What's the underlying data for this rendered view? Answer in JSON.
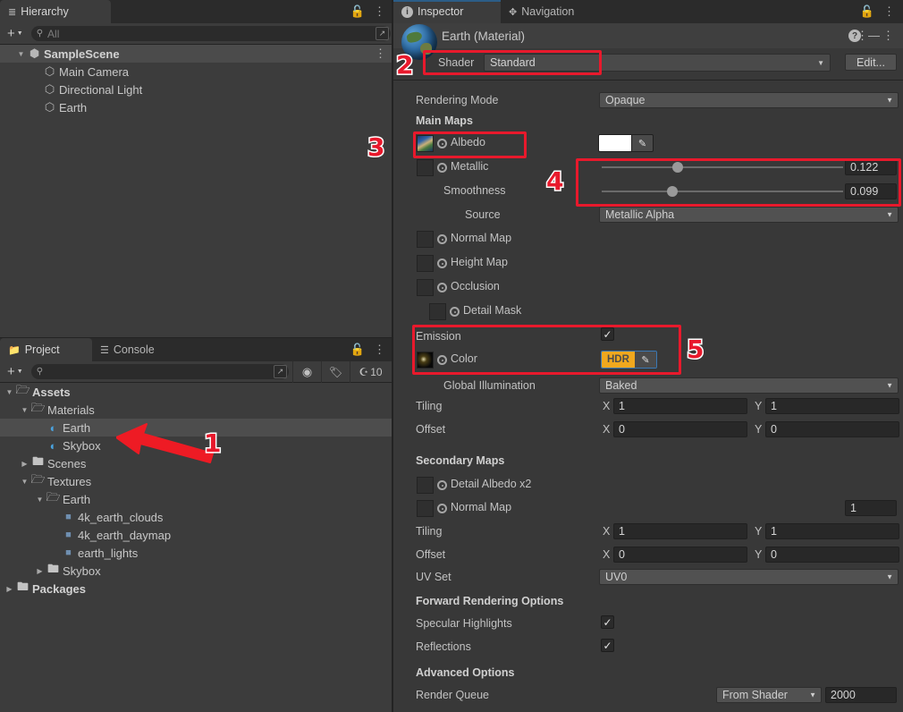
{
  "hierarchy": {
    "tab_label": "Hierarchy",
    "tab_icon": "hierarchy-icon",
    "lock_icon": "lock-icon",
    "menu_icon": "kebab-menu-icon",
    "add_label": "+",
    "search_placeholder": "All",
    "items": [
      {
        "label": "SampleScene",
        "icon": "scene-icon",
        "depth": 0,
        "expanded": true,
        "selected": false,
        "bold": true
      },
      {
        "label": "Main Camera",
        "icon": "gameobject-cube-icon",
        "depth": 1,
        "expanded": null,
        "selected": false,
        "bold": false
      },
      {
        "label": "Directional Light",
        "icon": "gameobject-cube-icon",
        "depth": 1,
        "expanded": null,
        "selected": false,
        "bold": false
      },
      {
        "label": "Earth",
        "icon": "gameobject-cube-icon",
        "depth": 1,
        "expanded": null,
        "selected": false,
        "bold": false
      }
    ]
  },
  "project": {
    "tab_label": "Project",
    "console_tab_label": "Console",
    "search_placeholder": "",
    "hidden_count": "10",
    "icons": [
      "folder-icon",
      "console-icon",
      "lock-icon",
      "kebab-menu-icon",
      "search-expand-icon",
      "shape-filter-icon",
      "tag-filter-icon",
      "hidden-eye-icon"
    ],
    "items": [
      {
        "label": "Assets",
        "icon": "folder-open-icon",
        "depth": 0,
        "expanded": true,
        "selected": false,
        "bold": true
      },
      {
        "label": "Materials",
        "icon": "folder-open-icon",
        "depth": 1,
        "expanded": true,
        "selected": false,
        "bold": false
      },
      {
        "label": "Earth",
        "icon": "material-ball-icon",
        "depth": 2,
        "expanded": null,
        "selected": true,
        "bold": false
      },
      {
        "label": "Skybox",
        "icon": "material-ball-icon",
        "depth": 2,
        "expanded": null,
        "selected": false,
        "bold": false
      },
      {
        "label": "Scenes",
        "icon": "folder-icon",
        "depth": 1,
        "expanded": false,
        "selected": false,
        "bold": false
      },
      {
        "label": "Textures",
        "icon": "folder-open-icon",
        "depth": 1,
        "expanded": true,
        "selected": false,
        "bold": false
      },
      {
        "label": "Earth",
        "icon": "folder-open-icon",
        "depth": 2,
        "expanded": true,
        "selected": false,
        "bold": false
      },
      {
        "label": "4k_earth_clouds",
        "icon": "texture-icon",
        "depth": 3,
        "expanded": null,
        "selected": false,
        "bold": false
      },
      {
        "label": "4k_earth_daymap",
        "icon": "texture-icon",
        "depth": 3,
        "expanded": null,
        "selected": false,
        "bold": false
      },
      {
        "label": "earth_lights",
        "icon": "texture-icon",
        "depth": 3,
        "expanded": null,
        "selected": false,
        "bold": false
      },
      {
        "label": "Skybox",
        "icon": "folder-icon",
        "depth": 2,
        "expanded": false,
        "selected": false,
        "bold": false
      },
      {
        "label": "Packages",
        "icon": "folder-icon",
        "depth": 0,
        "expanded": false,
        "selected": false,
        "bold": true
      }
    ]
  },
  "inspector": {
    "tab_label": "Inspector",
    "tab_icon": "info-icon",
    "navigation_tab_label": "Navigation",
    "navigation_tab_icon": "navigation-icon",
    "lock_icon": "lock-icon",
    "menu_icon": "kebab-menu-icon",
    "help_icon": "help-icon",
    "preset_icon": "preset-icon",
    "material_title": "Earth (Material)",
    "material_preview_icon": "earth-globe-icon",
    "shader_label": "Shader",
    "shader_value": "Standard",
    "edit_button": "Edit...",
    "rendering_mode_label": "Rendering Mode",
    "rendering_mode_value": "Opaque",
    "main_maps_header": "Main Maps",
    "albedo_label": "Albedo",
    "albedo_color": "#ffffff",
    "metallic_label": "Metallic",
    "metallic_value": "0.122",
    "metallic_fraction": 0.122,
    "smoothness_label": "Smoothness",
    "smoothness_value": "0.099",
    "smoothness_fraction": 0.099,
    "source_label": "Source",
    "source_value": "Metallic Alpha",
    "normal_map_label": "Normal Map",
    "height_map_label": "Height Map",
    "occlusion_label": "Occlusion",
    "detail_mask_label": "Detail Mask",
    "emission_label": "Emission",
    "emission_checked": true,
    "emission_color_label": "Color",
    "emission_hdr_label": "HDR",
    "emission_hdr_color": "#f0a81e",
    "global_illumination_label": "Global Illumination",
    "global_illumination_value": "Baked",
    "tiling_label": "Tiling",
    "offset_label": "Offset",
    "axis_x": "X",
    "axis_y": "Y",
    "main_tiling_x": "1",
    "main_tiling_y": "1",
    "main_offset_x": "0",
    "main_offset_y": "0",
    "secondary_maps_header": "Secondary Maps",
    "detail_albedo_label": "Detail Albedo x2",
    "secondary_normal_map_label": "Normal Map",
    "secondary_normal_scale": "1",
    "secondary_tiling_x": "1",
    "secondary_tiling_y": "1",
    "secondary_offset_x": "0",
    "secondary_offset_y": "0",
    "uv_set_label": "UV Set",
    "uv_set_value": "UV0",
    "forward_rendering_header": "Forward Rendering Options",
    "specular_highlights_label": "Specular Highlights",
    "specular_highlights_checked": true,
    "reflections_label": "Reflections",
    "reflections_checked": true,
    "advanced_options_header": "Advanced Options",
    "render_queue_label": "Render Queue",
    "render_queue_mode": "From Shader",
    "render_queue_value": "2000"
  },
  "annotations": {
    "color": "#e8192c",
    "markers": [
      {
        "number": "1",
        "target": "project-item-earth-material"
      },
      {
        "number": "2",
        "target": "shader-row"
      },
      {
        "number": "3",
        "target": "albedo-row"
      },
      {
        "number": "4",
        "target": "metallic-smoothness-sliders"
      },
      {
        "number": "5",
        "target": "emission-section"
      }
    ]
  }
}
